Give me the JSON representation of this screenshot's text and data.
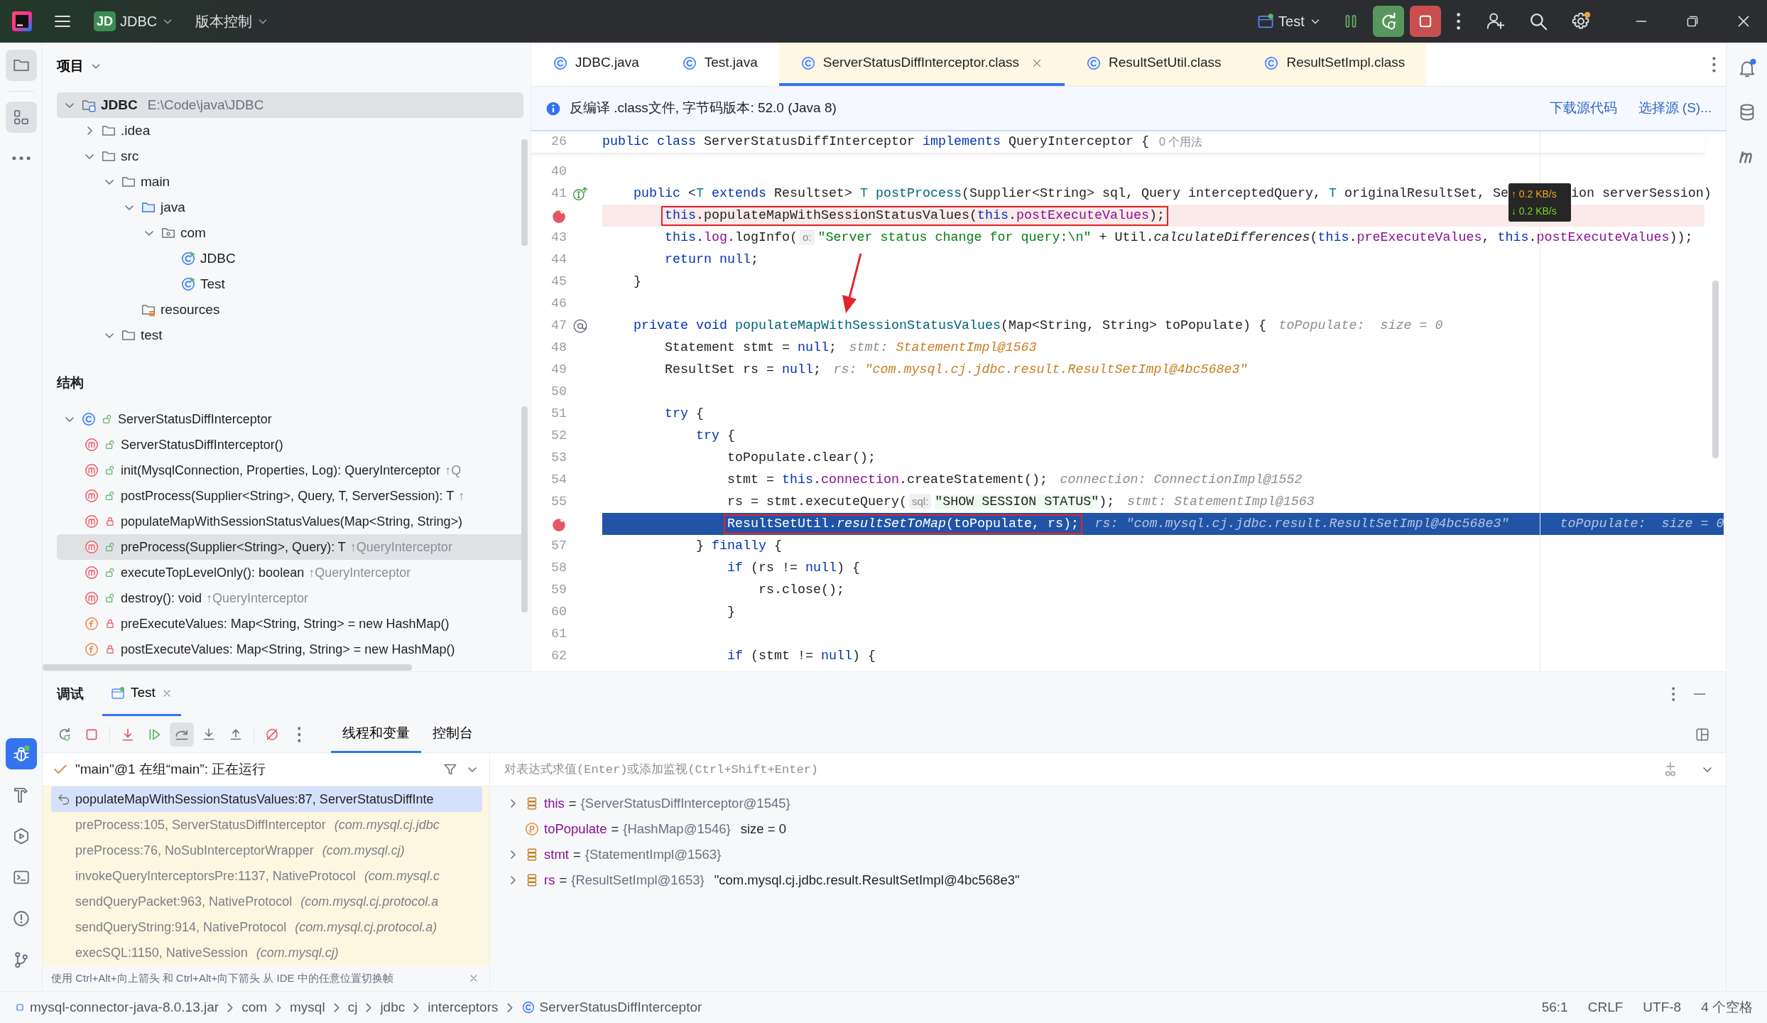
{
  "title_bar": {
    "project_badge": "JD",
    "project": "JDBC",
    "vcs": "版本控制",
    "run_config": "Test",
    "settings_badge": true
  },
  "left_toolbar": {
    "top": [
      {
        "kind": "project",
        "selected": true
      },
      {
        "kind": "structure",
        "selected": true
      },
      {
        "kind": "more",
        "selected": false
      }
    ],
    "bottom": [
      {
        "kind": "debug",
        "selected": true
      },
      {
        "kind": "build",
        "selected": false
      },
      {
        "kind": "services",
        "selected": false
      },
      {
        "kind": "terminal",
        "selected": false
      },
      {
        "kind": "problems",
        "selected": false
      },
      {
        "kind": "git",
        "selected": false
      }
    ]
  },
  "project": {
    "title": "项目",
    "tree": [
      {
        "kind": "module",
        "label": "JDBC",
        "path": "E:\\Code\\java\\JDBC",
        "expanded": true,
        "selected": true,
        "children": [
          {
            "kind": "folder",
            "label": ".idea",
            "expanded": false,
            "selected": false
          },
          {
            "kind": "folder",
            "label": "src",
            "expanded": true,
            "selected": false,
            "children": [
              {
                "kind": "folder",
                "label": "main",
                "expanded": true,
                "selected": false,
                "children": [
                  {
                    "kind": "source_folder",
                    "label": "java",
                    "expanded": true,
                    "selected": false,
                    "children": [
                      {
                        "kind": "package",
                        "label": "com",
                        "expanded": true,
                        "selected": false,
                        "children": [
                          {
                            "kind": "class",
                            "label": "JDBC",
                            "selected": false
                          },
                          {
                            "kind": "class",
                            "label": "Test",
                            "selected": false
                          }
                        ]
                      }
                    ]
                  },
                  {
                    "kind": "resource_folder",
                    "label": "resources",
                    "selected": false
                  }
                ]
              },
              {
                "kind": "folder",
                "label": "test",
                "expanded": true,
                "selected": false
              }
            ]
          }
        ]
      }
    ]
  },
  "structure": {
    "title": "结构",
    "tree": [
      {
        "kind": "class",
        "private": false,
        "label": "ServerStatusDiffInterceptor",
        "expanded": true,
        "selected": false,
        "children": [
          {
            "kind": "method",
            "private": false,
            "label": "ServerStatusDiffInterceptor()",
            "selected": false
          },
          {
            "kind": "method",
            "private": false,
            "label": "init(MysqlConnection, Properties, Log): QueryInterceptor",
            "inherited": "↑Q",
            "selected": false
          },
          {
            "kind": "method",
            "private": false,
            "label": "postProcess(Supplier<String>, Query, T, ServerSession): T",
            "inherited": "↑",
            "selected": false
          },
          {
            "kind": "method",
            "private": true,
            "label": "populateMapWithSessionStatusValues(Map<String, String>)",
            "selected": false
          },
          {
            "kind": "method",
            "private": false,
            "label": "preProcess(Supplier<String>, Query): T",
            "inherited": "↑QueryInterceptor",
            "selected": true
          },
          {
            "kind": "method",
            "private": false,
            "label": "executeTopLevelOnly(): boolean",
            "inherited": "↑QueryInterceptor",
            "selected": false
          },
          {
            "kind": "method",
            "private": false,
            "label": "destroy(): void",
            "inherited": "↑QueryInterceptor",
            "selected": false
          },
          {
            "kind": "field",
            "private": true,
            "label": "preExecuteValues: Map<String, String> = new HashMap()",
            "selected": false
          },
          {
            "kind": "field",
            "private": true,
            "label": "postExecuteValues: Map<String, String> = new HashMap()",
            "selected": false
          }
        ]
      }
    ]
  },
  "editor": {
    "tabs": [
      {
        "label": "JDBC.java",
        "external": false,
        "selected": false
      },
      {
        "label": "Test.java",
        "external": false,
        "selected": false
      },
      {
        "label": "ServerStatusDiffInterceptor.class",
        "external": true,
        "selected": true
      },
      {
        "label": "ResultSetUtil.class",
        "external": true,
        "selected": false
      },
      {
        "label": "ResultSetImpl.class",
        "external": true,
        "selected": false
      }
    ],
    "notice": {
      "text": "反编译 .class文件, 字节码版本: 52.0 (Java 8)",
      "actions": [
        "下载源代码",
        "选择源 (S)..."
      ]
    },
    "sticky": {
      "number": "26",
      "tokens": [
        {
          "kind": "keyword",
          "text": "public class"
        },
        {
          "kind": "plain",
          "text": " ServerStatusDiffInterceptor "
        },
        {
          "kind": "keyword",
          "text": "implements"
        },
        {
          "kind": "plain",
          "text": " QueryInterceptor {"
        }
      ],
      "usages": "0 个用法"
    },
    "lines": [
      {
        "number": "40",
        "breakpoint": false,
        "current": false
      },
      {
        "number": "41",
        "gutter": {
          "kind": "implements"
        },
        "breakpoint": false,
        "current": false,
        "tokens": [
          {
            "kind": "keyword",
            "text": "    public"
          },
          {
            "kind": "plain",
            "text": " <"
          },
          {
            "kind": "type",
            "text": "T"
          },
          {
            "kind": "keyword",
            "text": " extends"
          },
          {
            "kind": "plain",
            "text": " Resultset> "
          },
          {
            "kind": "type",
            "text": "T"
          },
          {
            "kind": "decl",
            "text": " postProcess"
          },
          {
            "kind": "plain",
            "text": "(Supplier<String> sql, Query interceptedQuery, "
          },
          {
            "kind": "type",
            "text": "T"
          },
          {
            "kind": "plain",
            "text": " originalResultSet, Se"
          }
        ],
        "overlay": {
          "upload": "↑ 0.2 KB/s",
          "download": "↓ 0.2 KB/s"
        },
        "after": [
          {
            "kind": "plain",
            "text": "ion serverSession)"
          }
        ]
      },
      {
        "breakpoint": true,
        "current": false,
        "boxed": [
          {
            "kind": "keyword",
            "text": "        this"
          },
          {
            "kind": "plain",
            "text": ".populateMapWithSessionStatusValues("
          },
          {
            "kind": "keyword",
            "text": "this"
          },
          {
            "kind": "plain",
            "text": "."
          },
          {
            "kind": "field",
            "text": "postExecuteValues"
          },
          {
            "kind": "plain",
            "text": ");"
          }
        ]
      },
      {
        "number": "43",
        "breakpoint": false,
        "current": false,
        "tokens": [
          {
            "kind": "keyword",
            "text": "        this"
          },
          {
            "kind": "plain",
            "text": "."
          },
          {
            "kind": "field",
            "text": "log"
          },
          {
            "kind": "plain",
            "text": ".logInfo("
          },
          {
            "kind": "param",
            "text": "o:"
          },
          {
            "kind": "string",
            "text": "\"Server status change for query:\\n\""
          },
          {
            "kind": "plain",
            "text": " + Util."
          },
          {
            "kind": "italic",
            "text": "calculateDifferences"
          },
          {
            "kind": "plain",
            "text": "("
          },
          {
            "kind": "keyword",
            "text": "this"
          },
          {
            "kind": "plain",
            "text": "."
          },
          {
            "kind": "field",
            "text": "preExecuteValues"
          },
          {
            "kind": "plain",
            "text": ", "
          },
          {
            "kind": "keyword",
            "text": "this"
          },
          {
            "kind": "plain",
            "text": "."
          },
          {
            "kind": "field",
            "text": "postExecuteValues"
          },
          {
            "kind": "plain",
            "text": "));"
          }
        ]
      },
      {
        "number": "44",
        "breakpoint": false,
        "current": false,
        "tokens": [
          {
            "kind": "keyword",
            "text": "        return"
          },
          {
            "kind": "keyword",
            "text": " null"
          },
          {
            "kind": "plain",
            "text": ";"
          }
        ]
      },
      {
        "number": "45",
        "breakpoint": false,
        "current": false,
        "tokens": [
          {
            "kind": "plain",
            "text": "    }"
          }
        ]
      },
      {
        "number": "46",
        "breakpoint": false,
        "current": false
      },
      {
        "number": "47",
        "gutter": {
          "kind": "annotation"
        },
        "breakpoint": false,
        "current": false,
        "tokens": [
          {
            "kind": "keyword",
            "text": "    private"
          },
          {
            "kind": "keyword",
            "text": " void"
          },
          {
            "kind": "decl",
            "text": " populateMapWithSessionStatusValues"
          },
          {
            "kind": "plain",
            "text": "(Map<String, String> toPopulate) {"
          },
          {
            "kind": "hint",
            "text": "toPopulate:  size = 0"
          }
        ]
      },
      {
        "number": "48",
        "breakpoint": false,
        "current": false,
        "tokens": [
          {
            "kind": "plain",
            "text": "        Statement stmt = "
          },
          {
            "kind": "keyword",
            "text": "null"
          },
          {
            "kind": "plain",
            "text": ";"
          },
          {
            "kind": "hint",
            "text": "stmt: "
          },
          {
            "kind": "value",
            "text": "StatementImpl@1563"
          }
        ]
      },
      {
        "number": "49",
        "breakpoint": false,
        "current": false,
        "tokens": [
          {
            "kind": "plain",
            "text": "        ResultSet rs = "
          },
          {
            "kind": "keyword",
            "text": "null"
          },
          {
            "kind": "plain",
            "text": ";"
          },
          {
            "kind": "hint",
            "text": "rs: "
          },
          {
            "kind": "value",
            "text": "\"com.mysql.cj.jdbc.result.ResultSetImpl@4bc568e3\""
          }
        ]
      },
      {
        "number": "50",
        "breakpoint": false,
        "current": false
      },
      {
        "number": "51",
        "breakpoint": false,
        "current": false,
        "tokens": [
          {
            "kind": "keyword",
            "text": "        try"
          },
          {
            "kind": "plain",
            "text": " {"
          }
        ]
      },
      {
        "number": "52",
        "breakpoint": false,
        "current": false,
        "tokens": [
          {
            "kind": "keyword",
            "text": "            try"
          },
          {
            "kind": "plain",
            "text": " {"
          }
        ]
      },
      {
        "number": "53",
        "breakpoint": false,
        "current": false,
        "tokens": [
          {
            "kind": "plain",
            "text": "                toPopulate.clear();"
          }
        ]
      },
      {
        "number": "54",
        "breakpoint": false,
        "current": false,
        "tokens": [
          {
            "kind": "plain",
            "text": "                stmt = "
          },
          {
            "kind": "keyword",
            "text": "this"
          },
          {
            "kind": "plain",
            "text": "."
          },
          {
            "kind": "field",
            "text": "connection"
          },
          {
            "kind": "plain",
            "text": ".createStatement();"
          },
          {
            "kind": "hint",
            "text": "connection: ConnectionImpl@1552"
          }
        ]
      },
      {
        "number": "55",
        "breakpoint": false,
        "current": false,
        "tokens": [
          {
            "kind": "plain",
            "text": "                rs = stmt.executeQuery("
          },
          {
            "kind": "param",
            "text": "sql:"
          },
          {
            "kind": "sql",
            "text": "\"SHOW SESSION STATUS\""
          },
          {
            "kind": "plain",
            "text": ");"
          },
          {
            "kind": "hint",
            "text": "stmt: StatementImpl@1563"
          }
        ]
      },
      {
        "breakpoint": true,
        "current": true,
        "boxed": [
          {
            "kind": "plain",
            "text": "                ResultSetUtil."
          },
          {
            "kind": "italic",
            "text": "resultSetToMap"
          },
          {
            "kind": "plain",
            "text": "(toPopulate, rs);"
          }
        ],
        "after": [
          {
            "kind": "hint",
            "text": "rs: \"com.mysql.cj.jdbc.result.ResultSetImpl@4bc568e3\""
          }
        ],
        "margin": [
          {
            "kind": "hint",
            "text": "toPopulate:  size = 0"
          }
        ]
      },
      {
        "number": "57",
        "breakpoint": false,
        "current": false,
        "tokens": [
          {
            "kind": "plain",
            "text": "            } "
          },
          {
            "kind": "keyword",
            "text": "finally"
          },
          {
            "kind": "plain",
            "text": " {"
          }
        ]
      },
      {
        "number": "58",
        "breakpoint": false,
        "current": false,
        "tokens": [
          {
            "kind": "keyword",
            "text": "                if"
          },
          {
            "kind": "plain",
            "text": " (rs != "
          },
          {
            "kind": "keyword",
            "text": "null"
          },
          {
            "kind": "plain",
            "text": ") {"
          }
        ]
      },
      {
        "number": "59",
        "breakpoint": false,
        "current": false,
        "tokens": [
          {
            "kind": "plain",
            "text": "                    rs.close();"
          }
        ]
      },
      {
        "number": "60",
        "breakpoint": false,
        "current": false,
        "tokens": [
          {
            "kind": "plain",
            "text": "                }"
          }
        ]
      },
      {
        "number": "61",
        "breakpoint": false,
        "current": false
      },
      {
        "number": "62",
        "breakpoint": false,
        "current": false,
        "tokens": [
          {
            "kind": "keyword",
            "text": "                if"
          },
          {
            "kind": "plain",
            "text": " (stmt != "
          },
          {
            "kind": "keyword",
            "text": "null"
          },
          {
            "kind": "plain",
            "text": ") {"
          }
        ]
      }
    ],
    "annotation_arrow": true
  },
  "right_toolbar": [
    {
      "kind": "notifications",
      "badge": true
    },
    {
      "kind": "database",
      "badge": false
    },
    {
      "kind": "maven",
      "badge": false
    }
  ],
  "debug": {
    "title": "调试",
    "sessions": [
      {
        "label": "Test",
        "selected": true
      }
    ],
    "toolbar": [
      {
        "kind": "rerun",
        "selected": false
      },
      {
        "kind": "stop",
        "selected": false
      },
      {
        "kind": "show_execution_point",
        "selected": false
      },
      {
        "kind": "resume",
        "selected": false
      },
      {
        "kind": "step_over",
        "selected": true
      },
      {
        "kind": "step_into",
        "selected": false
      },
      {
        "kind": "step_out",
        "selected": false
      },
      {
        "kind": "mute_breakpoints",
        "selected": false
      },
      {
        "kind": "more",
        "selected": false
      }
    ],
    "views": [
      {
        "label": "线程和变量",
        "selected": true
      },
      {
        "label": "控制台",
        "selected": false
      }
    ],
    "thread": "\"main\"@1 在组“main”: 正在运行",
    "frames": [
      {
        "location": "populateMapWithSessionStatusValues:87, ServerStatusDiffInte",
        "selected": true
      },
      {
        "location": "preProcess:105, ServerStatusDiffInterceptor",
        "package": "(com.mysql.cj.jdbc",
        "selected": false
      },
      {
        "location": "preProcess:76, NoSubInterceptorWrapper",
        "package": "(com.mysql.cj)",
        "selected": false
      },
      {
        "location": "invokeQueryInterceptorsPre:1137, NativeProtocol",
        "package": "(com.mysql.c",
        "selected": false
      },
      {
        "location": "sendQueryPacket:963, NativeProtocol",
        "package": "(com.mysql.cj.protocol.a",
        "selected": false
      },
      {
        "location": "sendQueryString:914, NativeProtocol",
        "package": "(com.mysql.cj.protocol.a)",
        "selected": false
      },
      {
        "location": "execSQL:1150, NativeSession",
        "package": "(com.mysql.cj)",
        "selected": false
      }
    ],
    "hint": "使用 Ctrl+Alt+向上箭头 和 Ctrl+Alt+向下箭头 从 IDE 中的任意位置切换帧",
    "watch": {
      "placeholder": "对表达式求值(Enter)或添加监视(Ctrl+Shift+Enter)"
    },
    "variables": [
      {
        "kind": "field",
        "name": "this",
        "operator": "=",
        "value": "{ServerStatusDiffInterceptor@1545}",
        "expanded": false
      },
      {
        "kind": "parameter",
        "name": "toPopulate",
        "operator": "=",
        "value": "{HashMap@1546}",
        "extra": "size = 0"
      },
      {
        "kind": "field",
        "name": "stmt",
        "operator": "=",
        "value": "{StatementImpl@1563}",
        "expanded": false
      },
      {
        "kind": "field",
        "name": "rs",
        "operator": "=",
        "value": "{ResultSetImpl@1653}",
        "extra": "\"com.mysql.cj.jdbc.result.ResultSetImpl@4bc568e3\"",
        "expanded": false
      }
    ]
  },
  "status_bar": {
    "breadcrumbs": [
      {
        "kind": "jar",
        "label": "mysql-connector-java-8.0.13.jar"
      },
      {
        "kind": "package",
        "label": "com"
      },
      {
        "kind": "package",
        "label": "mysql"
      },
      {
        "kind": "package",
        "label": "cj"
      },
      {
        "kind": "package",
        "label": "jdbc"
      },
      {
        "kind": "package",
        "label": "interceptors"
      },
      {
        "kind": "class",
        "label": "ServerStatusDiffInterceptor"
      }
    ],
    "position": "56:1",
    "line_separator": "CRLF",
    "encoding": "UTF-8",
    "indent": "4 个空格"
  }
}
